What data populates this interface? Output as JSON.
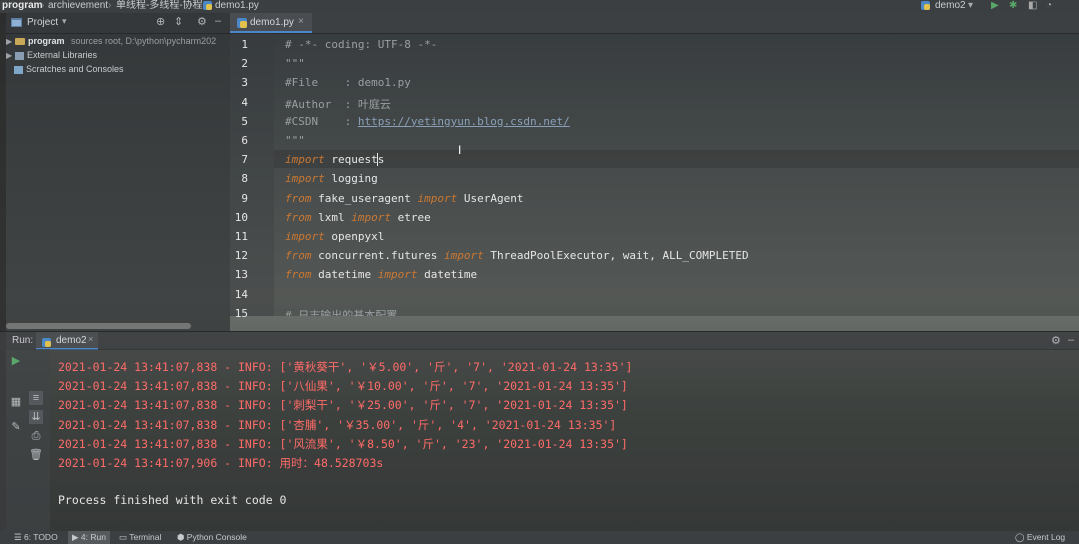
{
  "navbar": {
    "crumbs": [
      "program",
      "archievement",
      "单线程-多线程-协程",
      "demo1.py"
    ],
    "run_config": "demo2"
  },
  "project_panel": {
    "title": "Project",
    "tree": [
      {
        "label": "program",
        "detail": "sources root, D:\\python\\pycharm202"
      },
      {
        "label": "External Libraries"
      },
      {
        "label": "Scratches and Consoles"
      }
    ]
  },
  "editor": {
    "tab_label": "demo1.py",
    "line_numbers": [
      "1",
      "2",
      "3",
      "4",
      "5",
      "6",
      "7",
      "8",
      "9",
      "10",
      "11",
      "12",
      "13",
      "14",
      "15"
    ],
    "lines": [
      {
        "parts": [
          {
            "t": "# -*- coding: UTF-8 -*-",
            "c": "cmt"
          }
        ]
      },
      {
        "parts": [
          {
            "t": "\"\"\"",
            "c": "cmt"
          }
        ]
      },
      {
        "parts": [
          {
            "t": "#File    : demo1.py",
            "c": "cmt"
          }
        ]
      },
      {
        "parts": [
          {
            "t": "#Author  : 叶庭云",
            "c": "cmt"
          }
        ]
      },
      {
        "parts": [
          {
            "t": "#CSDN    : ",
            "c": "cmt"
          },
          {
            "t": "https://yetingyun.blog.csdn.net/",
            "c": "url"
          }
        ]
      },
      {
        "parts": [
          {
            "t": "\"\"\"",
            "c": "cmt"
          }
        ]
      },
      {
        "parts": [
          {
            "t": "import",
            "c": "kw"
          },
          {
            "t": " requests",
            "c": ""
          }
        ]
      },
      {
        "parts": [
          {
            "t": "import",
            "c": "kw"
          },
          {
            "t": " logging",
            "c": ""
          }
        ]
      },
      {
        "parts": [
          {
            "t": "from",
            "c": "kw"
          },
          {
            "t": " fake_useragent ",
            "c": ""
          },
          {
            "t": "import",
            "c": "kw"
          },
          {
            "t": " UserAgent",
            "c": ""
          }
        ]
      },
      {
        "parts": [
          {
            "t": "from",
            "c": "kw"
          },
          {
            "t": " lxml ",
            "c": ""
          },
          {
            "t": "import",
            "c": "kw"
          },
          {
            "t": " etree",
            "c": ""
          }
        ]
      },
      {
        "parts": [
          {
            "t": "import",
            "c": "kw"
          },
          {
            "t": " openpyxl",
            "c": ""
          }
        ]
      },
      {
        "parts": [
          {
            "t": "from",
            "c": "kw"
          },
          {
            "t": " concurrent.futures ",
            "c": ""
          },
          {
            "t": "import",
            "c": "kw"
          },
          {
            "t": " ThreadPoolExecutor, wait, ALL_COMPLETED",
            "c": ""
          }
        ]
      },
      {
        "parts": [
          {
            "t": "from",
            "c": "kw"
          },
          {
            "t": " datetime ",
            "c": ""
          },
          {
            "t": "import",
            "c": "kw"
          },
          {
            "t": " datetime",
            "c": ""
          }
        ]
      },
      {
        "parts": [
          {
            "t": "",
            "c": ""
          }
        ]
      },
      {
        "parts": [
          {
            "t": "# 日志输出的基本配置",
            "c": "cmt"
          }
        ]
      }
    ]
  },
  "run_panel": {
    "label": "Run:",
    "config_tab": "demo2",
    "console_lines": [
      {
        "text": "2021-01-24 13:41:07,838 - INFO: ['黄秋葵干', '￥5.00', '斤', '7', '2021-01-24 13:35']",
        "kind": "log"
      },
      {
        "text": "2021-01-24 13:41:07,838 - INFO: ['八仙果', '￥10.00', '斤', '7', '2021-01-24 13:35']",
        "kind": "log"
      },
      {
        "text": "2021-01-24 13:41:07,838 - INFO: ['刺梨干', '￥25.00', '斤', '7', '2021-01-24 13:35']",
        "kind": "log"
      },
      {
        "text": "2021-01-24 13:41:07,838 - INFO: ['杏脯', '￥35.00', '斤', '4', '2021-01-24 13:35']",
        "kind": "log"
      },
      {
        "text": "2021-01-24 13:41:07,838 - INFO: ['风流果', '￥8.50', '斤', '23', '2021-01-24 13:35']",
        "kind": "log"
      },
      {
        "text": "2021-01-24 13:41:07,906 - INFO: 用时：48.528703s",
        "kind": "log"
      },
      {
        "text": "",
        "kind": "plain"
      },
      {
        "text": "Process finished with exit code 0",
        "kind": "plain"
      }
    ]
  },
  "statusbar": {
    "items": [
      "6: TODO",
      "4: Run",
      "Terminal",
      "Python Console"
    ],
    "right": "Event Log"
  },
  "colors": {
    "keyword": "#cc7832",
    "comment": "#9a9fa3",
    "log_red": "#ff6b68",
    "accent": "#4a88c7"
  }
}
